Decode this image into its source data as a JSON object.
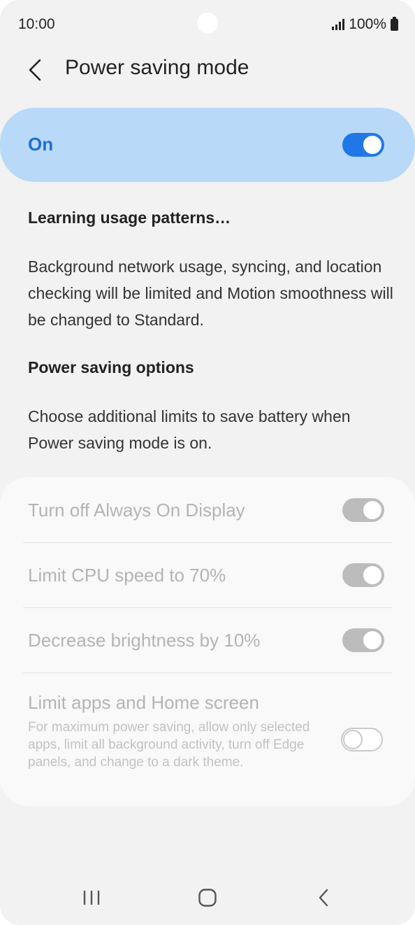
{
  "status_bar": {
    "time": "10:00",
    "battery": "100%"
  },
  "header": {
    "title": "Power saving mode"
  },
  "master_switch": {
    "label": "On",
    "state": "on"
  },
  "learning": {
    "title": "Learning usage patterns…"
  },
  "description": "Background network usage, syncing, and location checking will be limited and Motion smoothness will be changed to Standard.",
  "options_section": {
    "title": "Power saving options",
    "description": "Choose additional limits to save battery when Power saving mode is on."
  },
  "options": [
    {
      "label": "Turn off Always On Display",
      "state": "on",
      "enabled": false
    },
    {
      "label": "Limit CPU speed to 70%",
      "state": "on",
      "enabled": false
    },
    {
      "label": "Decrease brightness by 10%",
      "state": "on",
      "enabled": false
    },
    {
      "label": "Limit apps and Home screen",
      "description": "For maximum power saving, allow only selected apps, limit all background activity, turn off Edge panels, and change to a dark theme.",
      "state": "off",
      "enabled": false
    }
  ],
  "colors": {
    "accent": "#1f78e6",
    "master_bg": "#b8d9f8",
    "page_bg": "#f2f2f2"
  },
  "nav_bar": {
    "icons": [
      "recents-icon",
      "home-icon",
      "back-icon"
    ]
  }
}
